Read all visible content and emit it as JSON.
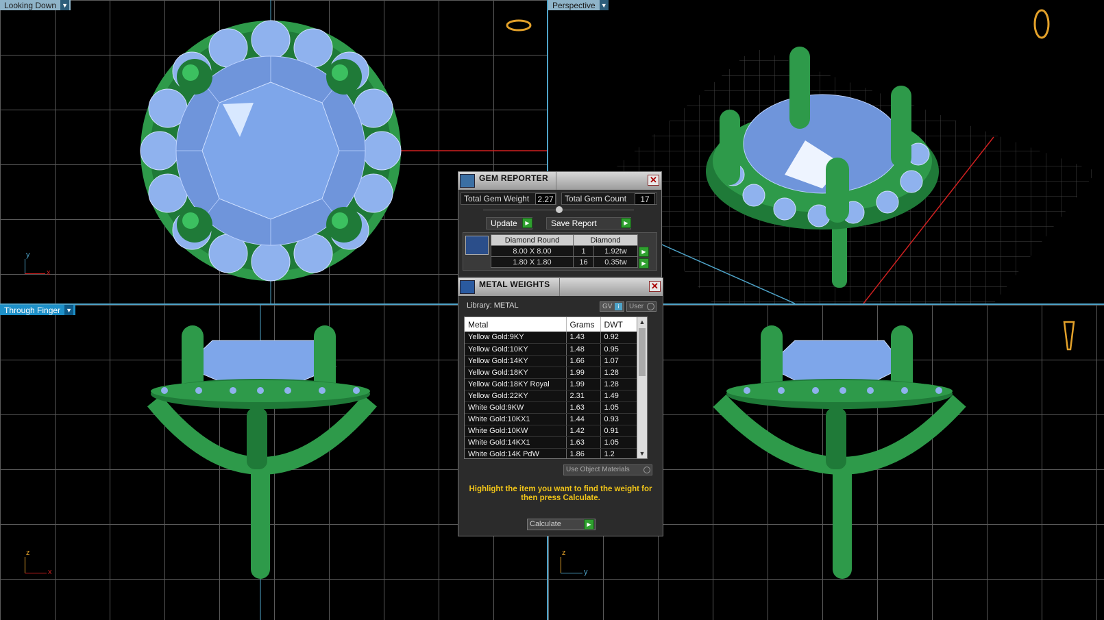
{
  "viewports": {
    "top_left": {
      "label": "Looking Down"
    },
    "top_right": {
      "label": "Perspective"
    },
    "bottom_left": {
      "label": "Through Finger"
    },
    "bottom_right": {
      "label": ""
    }
  },
  "axes": {
    "top_left": {
      "v": "y",
      "h": "x"
    },
    "bottom_left": {
      "v": "z",
      "h": "x"
    },
    "bottom_right": {
      "v": "z",
      "h": "y"
    }
  },
  "gem_reporter": {
    "title": "GEM REPORTER",
    "total_weight_label": "Total Gem Weight",
    "total_weight_value": "2.27",
    "total_count_label": "Total Gem Count",
    "total_count_value": "17",
    "update_label": "Update",
    "save_label": "Save Report",
    "table_headers": [
      "Diamond Round",
      "Diamond"
    ],
    "rows": [
      {
        "size": "8.00 X 8.00",
        "count": "1",
        "weight": "1.92tw"
      },
      {
        "size": "1.80 X 1.80",
        "count": "16",
        "weight": "0.35tw"
      }
    ]
  },
  "metal_weights": {
    "title": "METAL WEIGHTS",
    "library": "Library: METAL",
    "gv": "GV",
    "user": "User",
    "columns": [
      "Metal",
      "Grams",
      "DWT"
    ],
    "rows": [
      {
        "metal": "Yellow Gold:9KY",
        "grams": "1.43",
        "dwt": "0.92"
      },
      {
        "metal": "Yellow Gold:10KY",
        "grams": "1.48",
        "dwt": "0.95"
      },
      {
        "metal": "Yellow Gold:14KY",
        "grams": "1.66",
        "dwt": "1.07"
      },
      {
        "metal": "Yellow Gold:18KY",
        "grams": "1.99",
        "dwt": "1.28"
      },
      {
        "metal": "Yellow Gold:18KY Royal",
        "grams": "1.99",
        "dwt": "1.28"
      },
      {
        "metal": "Yellow Gold:22KY",
        "grams": "2.31",
        "dwt": "1.49"
      },
      {
        "metal": "White Gold:9KW",
        "grams": "1.63",
        "dwt": "1.05"
      },
      {
        "metal": "White Gold:10KX1",
        "grams": "1.44",
        "dwt": "0.93"
      },
      {
        "metal": "White Gold:10KW",
        "grams": "1.42",
        "dwt": "0.91"
      },
      {
        "metal": "White Gold:14KX1",
        "grams": "1.63",
        "dwt": "1.05"
      },
      {
        "metal": "White Gold:14K PdW",
        "grams": "1.86",
        "dwt": "1.2"
      }
    ],
    "use_object_materials": "Use Object Materials",
    "note": "Highlight the item you want to find the weight for then press Calculate.",
    "calculate_label": "Calculate"
  },
  "colors": {
    "metal": "#2e9a4a",
    "gem": "#7aa3e6",
    "accent": "#f0c419",
    "axis_red": "#d02020",
    "axis_blue": "#4ea3c8"
  }
}
